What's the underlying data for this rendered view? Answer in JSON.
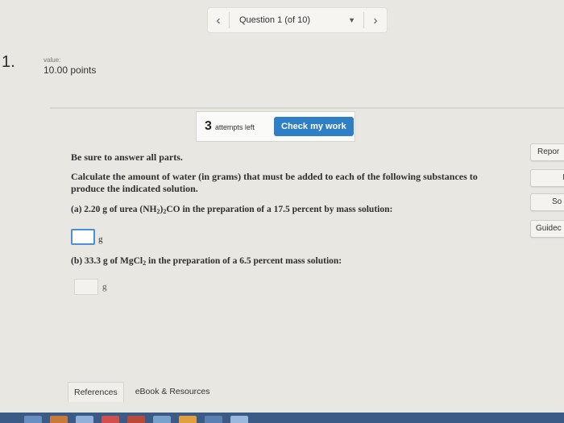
{
  "nav": {
    "prev_icon": "‹",
    "question_label": "Question 1 (of 10)",
    "dropdown_icon": "▼",
    "next_icon": "›"
  },
  "question": {
    "number": "1.",
    "value_label": "value:",
    "points": "10.00 points"
  },
  "attempts": {
    "count": "3",
    "label": "attempts left",
    "check_button": "Check my work"
  },
  "side_buttons": {
    "report": "Repor",
    "blank": "I",
    "solution": "So",
    "guided": "Guidec"
  },
  "content": {
    "instruction": "Be sure to answer all parts.",
    "question_text": "Calculate the amount of water (in grams) that must be added to each of the following substances to produce the indicated solution.",
    "part_a": {
      "prefix": "(a) 2.20 g of urea (NH",
      "sub1": "2",
      "mid": ")",
      "sub2": "2",
      "suffix": "CO in the preparation of a 17.5 percent by mass solution:",
      "unit": "g",
      "value": ""
    },
    "part_b": {
      "prefix": "(b) 33.3 g of MgCl",
      "sub1": "2",
      "suffix": " in the preparation of a 6.5 percent mass solution:",
      "unit": "g",
      "value": ""
    }
  },
  "tabs": {
    "references": "References",
    "ebook": "eBook & Resources"
  },
  "colors": {
    "accent": "#2e7fc6",
    "input_focus": "#4a90d9",
    "taskbar": "#3b5a86"
  }
}
